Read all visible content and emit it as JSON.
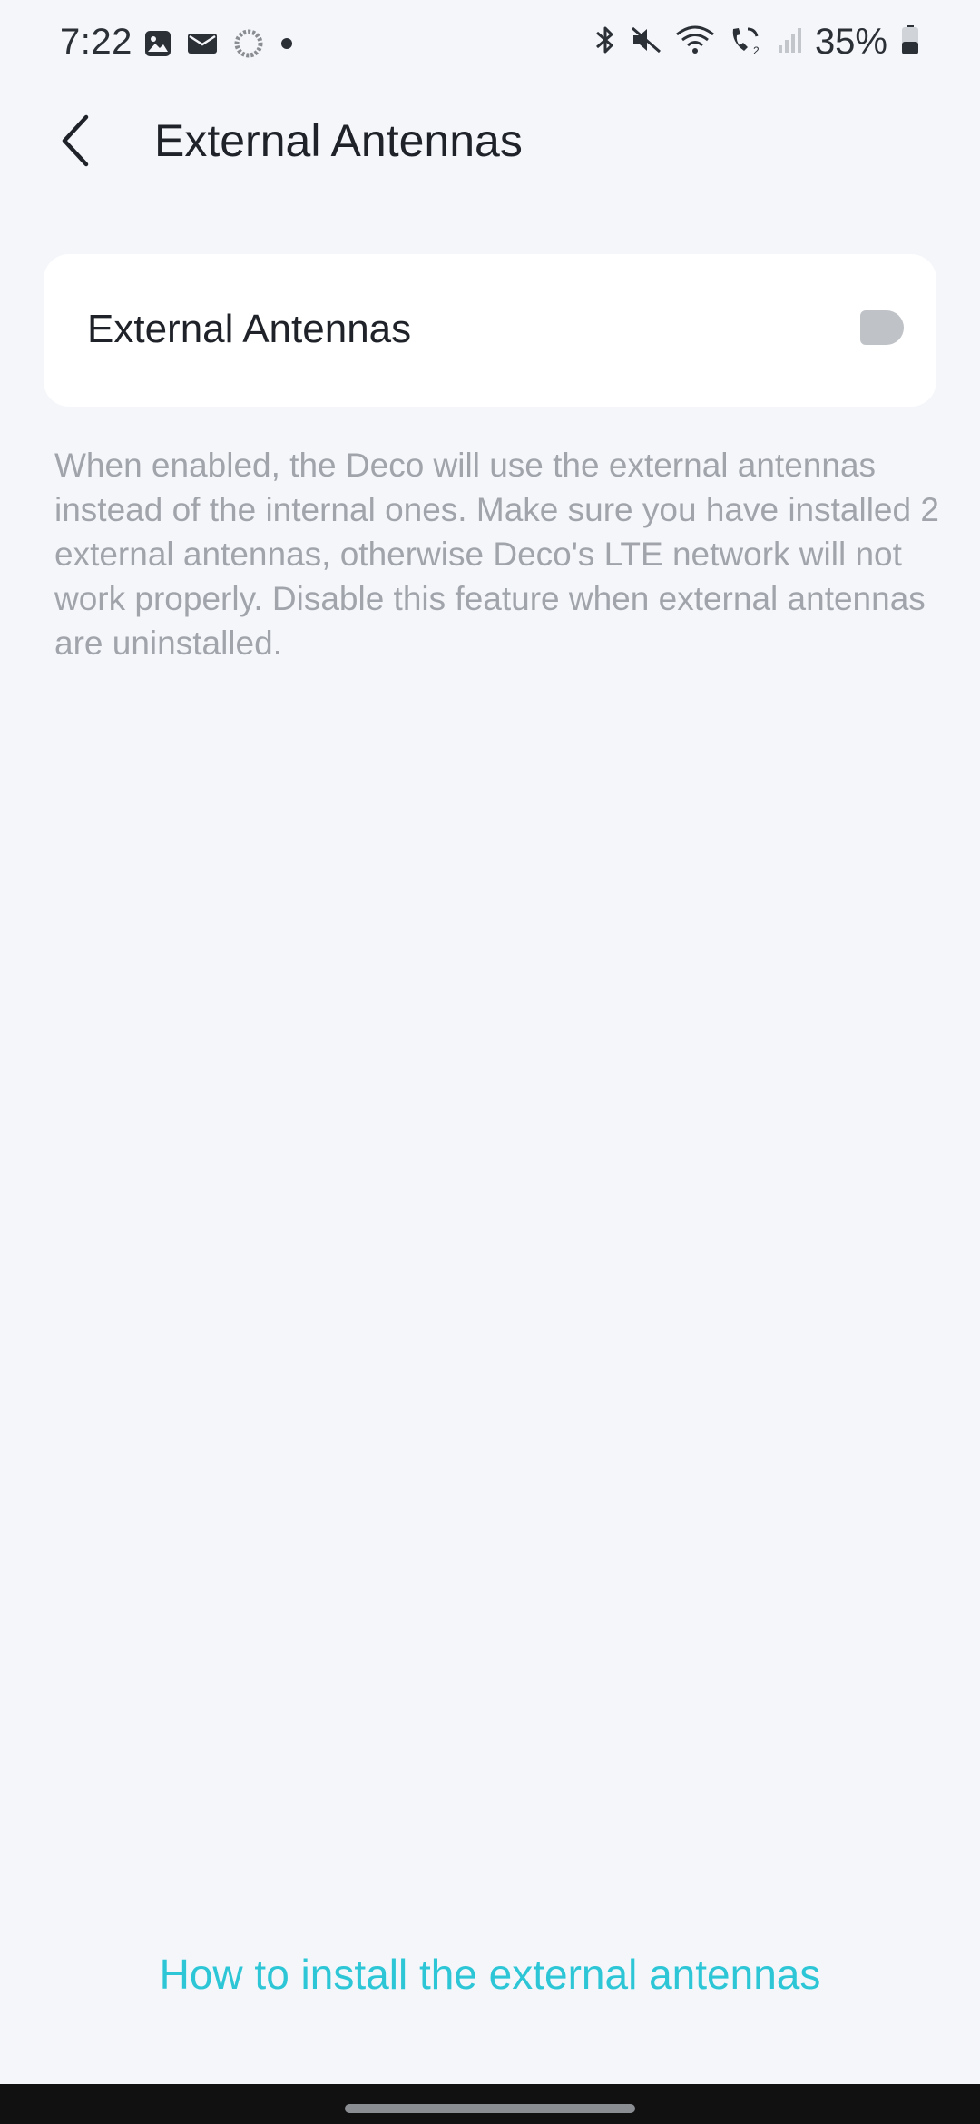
{
  "status_bar": {
    "time": "7:22",
    "battery": "35%",
    "left_icons": [
      "gallery-icon",
      "mail-icon",
      "sync-icon",
      "dot-icon"
    ],
    "right_icons": [
      "bluetooth-icon",
      "mute-icon",
      "wifi-icon",
      "wifi-calling-icon",
      "signal-icon",
      "battery-icon"
    ]
  },
  "header": {
    "title": "External Antennas",
    "back_icon": "chevron-left-icon"
  },
  "settings": {
    "external_antennas": {
      "label": "External Antennas",
      "enabled": false
    },
    "description": "When enabled, the Deco will use the external antennas instead of the internal ones. Make sure you have installed 2 external antennas, otherwise Deco's LTE network will not work properly. Disable this feature when external antennas are uninstalled."
  },
  "footer": {
    "link_label": "How to install the external antennas"
  },
  "colors": {
    "background": "#f4f6fa",
    "card": "#ffffff",
    "accent_link": "#2cc6d6",
    "description_text": "#a1a5ab",
    "toggle_off": "#bfc2c7"
  }
}
